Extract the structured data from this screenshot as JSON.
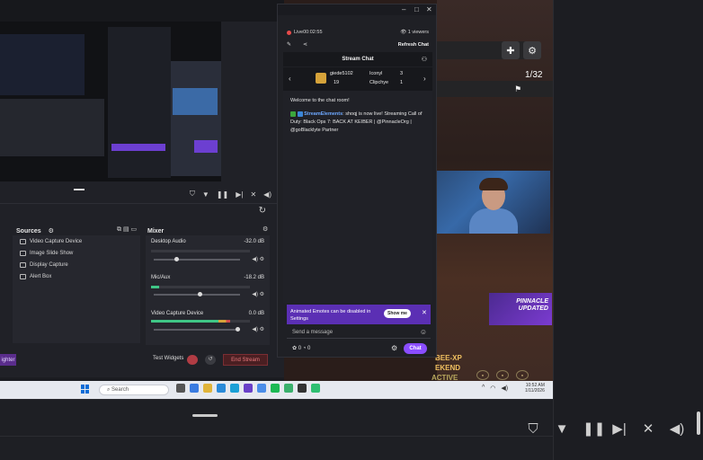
{
  "outer": {
    "viewer_count": "0",
    "page_counter": "1/32",
    "bottom_controls": [
      "shield",
      "filter",
      "pause",
      "skip",
      "mute-mic",
      "volume"
    ]
  },
  "studio": {
    "sources_title": "Sources",
    "mixer_title": "Mixer",
    "sources": [
      "Video Capture Device",
      "Image Slide Show",
      "Display Capture",
      "Alert Box"
    ],
    "mixer": [
      {
        "label": "Desktop Audio",
        "db": "-32.0 dB"
      },
      {
        "label": "Mic/Aux",
        "db": "-18.2 dB"
      },
      {
        "label": "Video Capture Device",
        "db": "0.0 dB"
      }
    ],
    "highlighter_label": "ighter",
    "test_widgets_label": "Test Widgets",
    "end_stream_label": "End Stream"
  },
  "chat": {
    "live_label": "Live",
    "live_time": "00:02:55",
    "viewers_label": "1 viewers",
    "refresh_label": "Refresh Chat",
    "title": "Stream Chat",
    "leaders": [
      {
        "name": "giede5102",
        "value": "19"
      },
      {
        "name": "Iconyl",
        "value": "3"
      },
      {
        "name": "Clipchye",
        "value": "1"
      }
    ],
    "welcome": "Welcome to the chat room!",
    "message_user": "StreamElements",
    "message_text": ": shoqj is now live! Streaming Call of Duty: Black Ops 7: BACK AT KEIBER | @PinnacleOrg | @goBlacklyte Partner",
    "notice_text": "Animated Emotes can be disabled in Settings",
    "notice_button": "Show me",
    "input_placeholder": "Send a message",
    "points_a": "0",
    "points_b": "0",
    "send_label": "Chat"
  },
  "game": {
    "promo_text": "PINNACLE UPDATED",
    "line1": "BEE-XP",
    "line2": "EKEND",
    "line3": "ACTIVE"
  },
  "taskbar": {
    "search_placeholder": "Search",
    "time": "10:52 AM",
    "date": "1/11/2026"
  },
  "colors": {
    "accent_purple": "#8a4dff",
    "live_red": "#e84a4a",
    "meter_green": "#3fc686",
    "notice_bg": "#5b2fb4"
  }
}
